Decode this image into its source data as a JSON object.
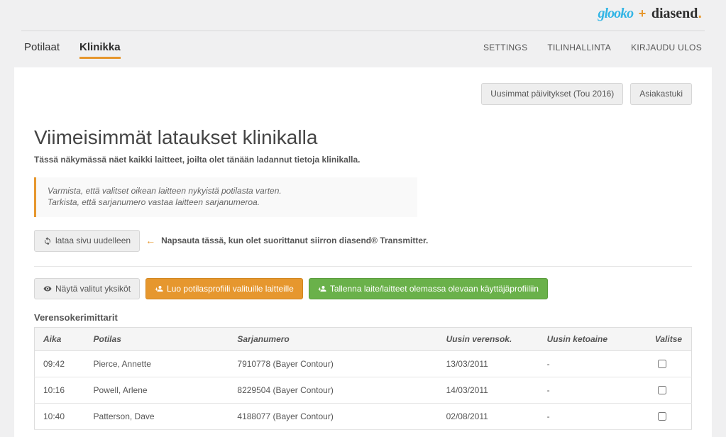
{
  "brand": {
    "glooko": "glooko",
    "plus": "+",
    "diasend": "diasend",
    "dot": "."
  },
  "nav": {
    "left": [
      "Potilaat",
      "Klinikka"
    ],
    "active_index": 1,
    "right": [
      "SETTINGS",
      "TILINHALLINTA",
      "KIRJAUDU ULOS"
    ]
  },
  "topbuttons": {
    "updates": "Uusimmat päivitykset (Tou 2016)",
    "support": "Asiakastuki"
  },
  "page": {
    "title": "Viimeisimmät lataukset klinikalla",
    "subtitle": "Tässä näkymässä näet kaikki laitteet, joilta olet tänään ladannut tietoja klinikalla.",
    "notice_line1": "Varmista, että valitset oikean laitteen nykyistä potilasta varten.",
    "notice_line2": "Tarkista, että sarjanumero vastaa laitteen sarjanumeroa.",
    "reload_label": "lataa sivu uudelleen",
    "reload_hint": "Napsauta tässä, kun olet suorittanut siirron diasend® Transmitter."
  },
  "actions": {
    "show_selected": "Näytä valitut yksiköt",
    "create_profile": "Luo potilasprofiili valituille laitteille",
    "save_device": "Tallenna laite/laitteet olemassa olevaan käyttäjäprofiiliin"
  },
  "table": {
    "section_label": "Verensokerimittarit",
    "headers": {
      "time": "Aika",
      "patient": "Potilas",
      "serial": "Sarjanumero",
      "latest_glucose": "Uusin verensok.",
      "latest_ketone": "Uusin ketoaine",
      "select": "Valitse"
    },
    "rows": [
      {
        "time": "09:42",
        "patient": "Pierce, Annette",
        "serial": "7910778 (Bayer Contour)",
        "glucose": "13/03/2011",
        "ketone": "-"
      },
      {
        "time": "10:16",
        "patient": "Powell, Arlene",
        "serial": "8229504 (Bayer Contour)",
        "glucose": "14/03/2011",
        "ketone": "-"
      },
      {
        "time": "10:40",
        "patient": "Patterson, Dave",
        "serial": "4188077 (Bayer Contour)",
        "glucose": "02/08/2011",
        "ketone": "-"
      }
    ]
  }
}
